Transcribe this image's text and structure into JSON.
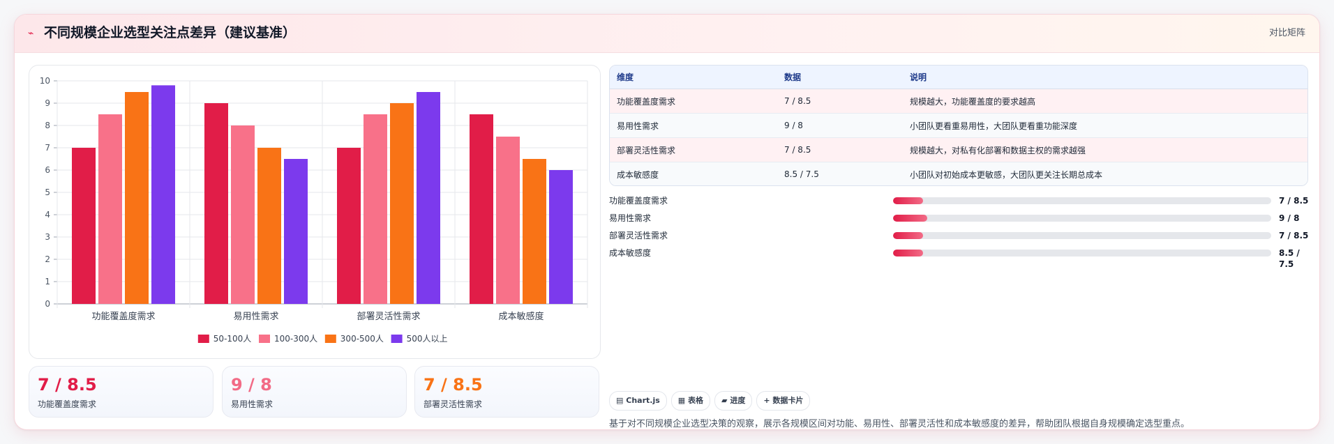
{
  "header": {
    "icon": "trend-icon",
    "title": "不同规模企业选型关注点差异（建议基准）",
    "badge": "对比矩阵"
  },
  "chart_data": {
    "type": "bar",
    "categories": [
      "功能覆盖度需求",
      "易用性需求",
      "部署灵活性需求",
      "成本敏感度"
    ],
    "series": [
      {
        "name": "50-100人",
        "color": "#e11d48",
        "values": [
          7,
          9,
          7,
          8.5
        ]
      },
      {
        "name": "100-300人",
        "color": "#f87189",
        "values": [
          8.5,
          8,
          8.5,
          7.5
        ]
      },
      {
        "name": "300-500人",
        "color": "#f97316",
        "values": [
          9.5,
          7,
          9,
          6.5
        ]
      },
      {
        "name": "500人以上",
        "color": "#7c3aed",
        "values": [
          9.8,
          6.5,
          9.5,
          6
        ]
      }
    ],
    "ylim": [
      0,
      10
    ],
    "yticks": [
      "0",
      "1",
      "2",
      "3",
      "4",
      "5",
      "6",
      "7",
      "8",
      "9",
      "10"
    ],
    "grid": true,
    "legend": "bottom"
  },
  "kpis": [
    {
      "value": "7 / 8.5",
      "label": "功能覆盖度需求",
      "color": "#e11d48"
    },
    {
      "value": "9 / 8",
      "label": "易用性需求",
      "color": "#f26b86"
    },
    {
      "value": "7 / 8.5",
      "label": "部署灵活性需求",
      "color": "#f97316"
    }
  ],
  "table": {
    "headers": [
      "维度",
      "数据",
      "说明"
    ],
    "rows": [
      [
        "功能覆盖度需求",
        "7 / 8.5",
        "规模越大，功能覆盖度的要求越高"
      ],
      [
        "易用性需求",
        "9 / 8",
        "小团队更看重易用性，大团队更看重功能深度"
      ],
      [
        "部署灵活性需求",
        "7 / 8.5",
        "规模越大，对私有化部署和数据主权的需求越强"
      ],
      [
        "成本敏感度",
        "8.5 / 7.5",
        "小团队对初始成本更敏感，大团队更关注长期总成本"
      ]
    ]
  },
  "progress": [
    {
      "label": "功能覆盖度需求",
      "value": "7 / 8.5",
      "fill": 0.08
    },
    {
      "label": "易用性需求",
      "value": "9 / 8",
      "fill": 0.09
    },
    {
      "label": "部署灵活性需求",
      "value": "7 / 8.5",
      "fill": 0.08
    },
    {
      "label": "成本敏感度",
      "value": "8.5 / 7.5",
      "fill": 0.08
    }
  ],
  "chips": [
    {
      "icon": "chart-icon",
      "glyph": "▤",
      "label": "Chart.js"
    },
    {
      "icon": "table-icon",
      "glyph": "▦",
      "label": "表格"
    },
    {
      "icon": "progress-icon",
      "glyph": "▰",
      "label": "进度"
    },
    {
      "icon": "plus-icon",
      "glyph": "+",
      "label": "数据卡片"
    }
  ],
  "note": "基于对不同规模企业选型决策的观察，展示各规模区间对功能、易用性、部署灵活性和成本敏感度的差异，帮助团队根据自身规模确定选型重点。"
}
